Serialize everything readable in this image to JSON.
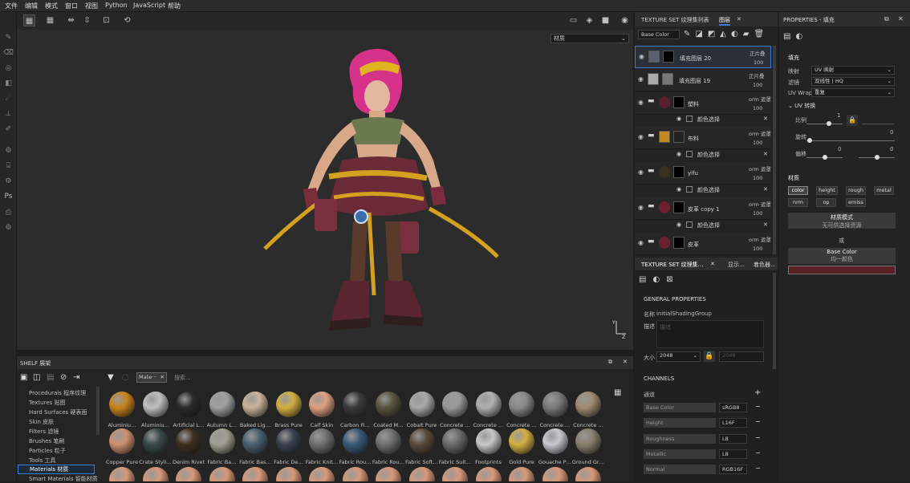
{
  "menubar": {
    "items": [
      "文件",
      "编辑",
      "模式",
      "窗口",
      "视图",
      "Python",
      "JavaScript",
      "帮助"
    ]
  },
  "viewport": {
    "material_mode": "材质"
  },
  "layers_panel": {
    "tab_texture_set_list": "TEXTURE SET 纹理集列表",
    "tab_layers": "图层",
    "channel": "Base Color",
    "layers": [
      {
        "name": "填充图层 20",
        "blend": "正片叠",
        "opacity": "100"
      },
      {
        "name": "填充图层 19",
        "blend": "正片叠",
        "opacity": "100"
      },
      {
        "name": "塑料",
        "blend": "orm 遮罩",
        "opacity": "100",
        "sub": "颜色选择"
      },
      {
        "name": "布料",
        "blend": "orm 遮罩",
        "opacity": "100",
        "sub": "颜色选择"
      },
      {
        "name": "yifu",
        "blend": "orm 遮罩",
        "opacity": "100",
        "sub": "颜色选择"
      },
      {
        "name": "皮革 copy 1",
        "blend": "orm 遮罩",
        "opacity": "100",
        "sub": "颜色选择"
      },
      {
        "name": "皮革",
        "blend": "orm 遮罩",
        "opacity": "100"
      }
    ]
  },
  "texture_set_settings": {
    "tab1": "TEXTURE SET 纹理集…",
    "tab2": "显示…",
    "tab3": "着色器…",
    "general_header": "GENERAL PROPERTIES",
    "name_label": "名称",
    "name_value": "initialShadingGroup",
    "desc_label": "描述",
    "desc_placeholder": "描述",
    "size_label": "大小",
    "size_value": "2048",
    "size_value2": "2048",
    "channels_header": "CHANNELS",
    "channels_label": "通道",
    "channels": [
      {
        "name": "Base Color",
        "format": "sRGB8"
      },
      {
        "name": "Height",
        "format": "L16F"
      },
      {
        "name": "Roughness",
        "format": "L8"
      },
      {
        "name": "Metallic",
        "format": "L8"
      },
      {
        "name": "Normal",
        "format": "RGB16F"
      }
    ]
  },
  "properties": {
    "title": "PROPERTIES - 填充",
    "fill_header": "填充",
    "mapping_label": "映射",
    "mapping_value": "UV 映射",
    "filter_label": "滤镜",
    "filter_value": "双线性 | HQ",
    "uvwrap_label": "UV Wrap",
    "uvwrap_value": "重复",
    "uv_transform": "UV 转换",
    "scale_label": "比例",
    "scale_value": "1",
    "rotation_label": "旋转",
    "rotation_value": "0",
    "offset_label": "偏移",
    "offset_value_x": "0",
    "offset_value_y": "0",
    "material_header": "材质",
    "chips": [
      "color",
      "height",
      "rough",
      "metal",
      "nrm",
      "op",
      "emiss"
    ],
    "material_mode_title": "材质模式",
    "material_mode_sub": "无可供选择资源",
    "or_label": "或",
    "base_color_title": "Base Color",
    "base_color_sub": "均一颜色",
    "base_color_swatch": "#5a1f24"
  },
  "shelf": {
    "title": "SHELF 展架",
    "filter_chip": "Mate···",
    "search_placeholder": "搜索...",
    "categories": [
      "Procedurals 程序纹理",
      "Textures 贴图",
      "Hard Surfaces 硬表面",
      "Skin 皮肤",
      "Filters 滤镜",
      "Brushes 笔刷",
      "Particles 粒子",
      "Tools 工具",
      "Materials 材质",
      "Smart Materials 智能材质"
    ],
    "selected_category": "Materials 材质",
    "row1": [
      "Aluminiu…",
      "Aluminiu…",
      "Artificial L…",
      "Autumn L…",
      "Baked Lig…",
      "Brass Pure",
      "Calf Skin",
      "Carbon Fi…",
      "Coated M…",
      "Cobalt Pure",
      "Concrete …",
      "Concrete …",
      "Concrete …",
      "Concrete …",
      "Concrete …"
    ],
    "row2": [
      "Copper Pure",
      "Crate Styli…",
      "Denim Rivet",
      "Fabric Ba…",
      "Fabric Bas…",
      "Fabric De…",
      "Fabric Knit…",
      "Fabric Rou…",
      "Fabric Rou…",
      "Fabric Soft…",
      "Fabric Suit…",
      "Footprints",
      "Gold Pure",
      "Gouache P…",
      "Ground Gr…"
    ]
  }
}
